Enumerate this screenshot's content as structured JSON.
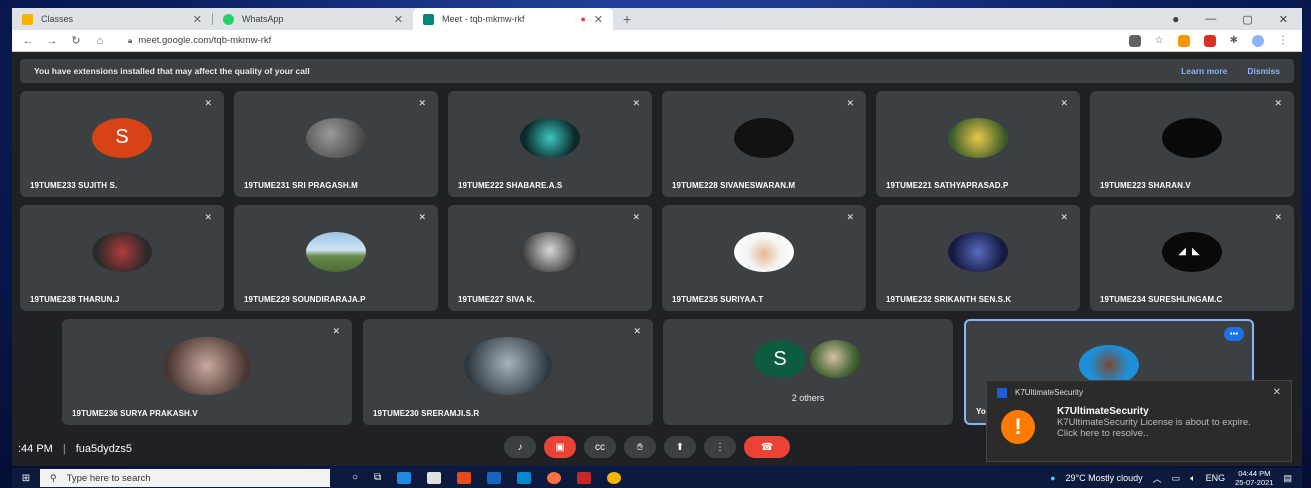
{
  "browser": {
    "tabs": [
      {
        "label": "Classes",
        "color": "#f4b400"
      },
      {
        "label": "WhatsApp",
        "color": "#25d366"
      },
      {
        "label": "Meet - tqb-mkmw-rkf",
        "color": "#00897b"
      }
    ],
    "new_tab": "+",
    "address": "meet.google.com/tqb-mkmw-rkf"
  },
  "banner": {
    "message": "You have extensions installed that may affect the quality of your call",
    "learn_more": "Learn more",
    "dismiss": "Dismiss"
  },
  "participants_row1": [
    {
      "name": "19TUME233 SUJITH S.",
      "initial": "S",
      "color": "#d84315"
    },
    {
      "name": "19TUME231 SRI PRAGASH.M",
      "color": "#6b6b6b"
    },
    {
      "name": "19TUME222 SHABARE.A.S",
      "color": "#0f3d3a"
    },
    {
      "name": "19TUME228 SIVANESWARAN.M",
      "color": "#121212"
    },
    {
      "name": "19TUME221 SATHYAPRASAD.P",
      "color": "#c8a73a"
    },
    {
      "name": "19TUME223 SHARAN.V",
      "color": "#0a0a0a"
    }
  ],
  "participants_row2": [
    {
      "name": "19TUME238 THARUN.J",
      "color": "#5a2a2a"
    },
    {
      "name": "19TUME229 SOUNDIRARAJA.P",
      "color": "#9cc5e6"
    },
    {
      "name": "19TUME227 SIVA K.",
      "color": "#8a8a8a"
    },
    {
      "name": "19TUME235 SURIYAA.T",
      "color": "#f2f2f2"
    },
    {
      "name": "19TUME232 SRIKANTH SEN.S.K",
      "color": "#1c2560"
    },
    {
      "name": "19TUME234 SURESHLINGAM.C",
      "color": "#0a0a0a"
    }
  ],
  "participants_row3": [
    {
      "name": "19TUME236 SURYA PRAKASH.V",
      "color": "#7a5b53"
    },
    {
      "name": "19TUME230 SRERAMJI.S.R",
      "color": "#4f5a63"
    }
  ],
  "others": {
    "initial": "S",
    "label": "2 others"
  },
  "self_tile": {
    "label": "Yo"
  },
  "meeting": {
    "time": ":44 PM",
    "code": "fua5dydzs5"
  },
  "toast": {
    "app": "K7UltimateSecurity",
    "title": "K7UltimateSecurity",
    "line1": "K7UltimateSecurity License is about to expire.",
    "line2": "Click here to resolve.."
  },
  "taskbar": {
    "search_placeholder": "Type here to search",
    "weather": "29°C  Mostly cloudy",
    "lang": "ENG",
    "time": "04:44 PM",
    "date": "25-07-2021"
  }
}
